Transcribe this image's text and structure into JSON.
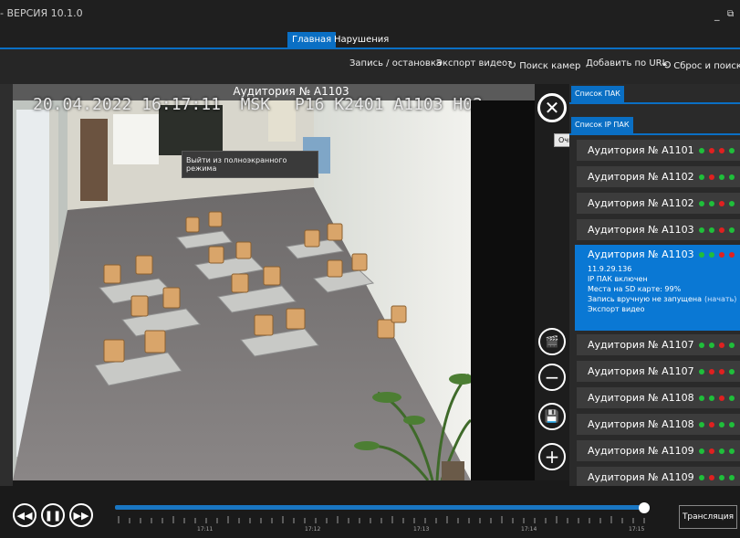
{
  "window": {
    "title": "- ВЕРСИЯ 10.1.0",
    "minimize": "_",
    "maximize": "⧉"
  },
  "nav": {
    "tabs": [
      {
        "label": "Главная",
        "active": true
      },
      {
        "label": "Нарушения",
        "active": false
      }
    ]
  },
  "toolbar": {
    "record": "Запись / остановка",
    "export": "Экспорт видео",
    "search_cam": "Поиск камер",
    "add_url": "Добавить по URL",
    "reset_search": "Сброс и поиск ПАК"
  },
  "video": {
    "title": "Аудитория № А1103",
    "osd_left": "20.04.2022 16:17:11  MSK",
    "osd_right": "P16 K2401 A1103 H02",
    "exit_fullscreen_tip": "Выйти из полноэкранного режима",
    "clear_tip": "Очистить"
  },
  "panel": {
    "tab_pak": "Список ПАК",
    "tab_ippak": "Список IP ПАК",
    "items": [
      {
        "name": "Аудитория № А1101",
        "dots": [
          "#1fbf3a",
          "#e02020",
          "#e02020",
          "#1fbf3a"
        ]
      },
      {
        "name": "Аудитория № А1102",
        "dots": [
          "#1fbf3a",
          "#e02020",
          "#1fbf3a",
          "#1fbf3a"
        ]
      },
      {
        "name": "Аудитория № А1102",
        "dots": [
          "#1fbf3a",
          "#1fbf3a",
          "#e02020",
          "#1fbf3a"
        ]
      },
      {
        "name": "Аудитория № А1103",
        "dots": [
          "#1fbf3a",
          "#1fbf3a",
          "#e02020",
          "#1fbf3a"
        ]
      },
      {
        "name": "Аудитория № А1103",
        "dots": [
          "#1fbf3a",
          "#1fbf3a",
          "#e02020",
          "#e02020"
        ]
      },
      {
        "name": "Аудитория № А1107",
        "dots": [
          "#1fbf3a",
          "#1fbf3a",
          "#e02020",
          "#1fbf3a"
        ]
      },
      {
        "name": "Аудитория № А1107",
        "dots": [
          "#1fbf3a",
          "#e02020",
          "#e02020",
          "#1fbf3a"
        ]
      },
      {
        "name": "Аудитория № А1108",
        "dots": [
          "#1fbf3a",
          "#1fbf3a",
          "#e02020",
          "#1fbf3a"
        ]
      },
      {
        "name": "Аудитория № А1108",
        "dots": [
          "#1fbf3a",
          "#e02020",
          "#1fbf3a",
          "#1fbf3a"
        ]
      },
      {
        "name": "Аудитория № А1109",
        "dots": [
          "#1fbf3a",
          "#e02020",
          "#1fbf3a",
          "#1fbf3a"
        ]
      },
      {
        "name": "Аудитория № А1109",
        "dots": [
          "#1fbf3a",
          "#e02020",
          "#1fbf3a",
          "#1fbf3a"
        ]
      }
    ],
    "active_index": 4,
    "active_details": {
      "ip": "11.9.29.136",
      "ip_status": "IP ПАК включен",
      "sd": "Места на SD карте: 99%",
      "rec": "Запись вручную не запущена",
      "rec_action": "(начать)",
      "export": "Экспорт видео"
    }
  },
  "timeline": {
    "labels": [
      "17:11",
      "17:12",
      "17:13",
      "17:14",
      "17:15"
    ],
    "progress": 0.99,
    "broadcast": "Трансляция"
  },
  "colors": {
    "accent": "#0a6fc4",
    "active_item": "#0a78d4",
    "dot_green": "#1fbf3a",
    "dot_red": "#e02020"
  }
}
